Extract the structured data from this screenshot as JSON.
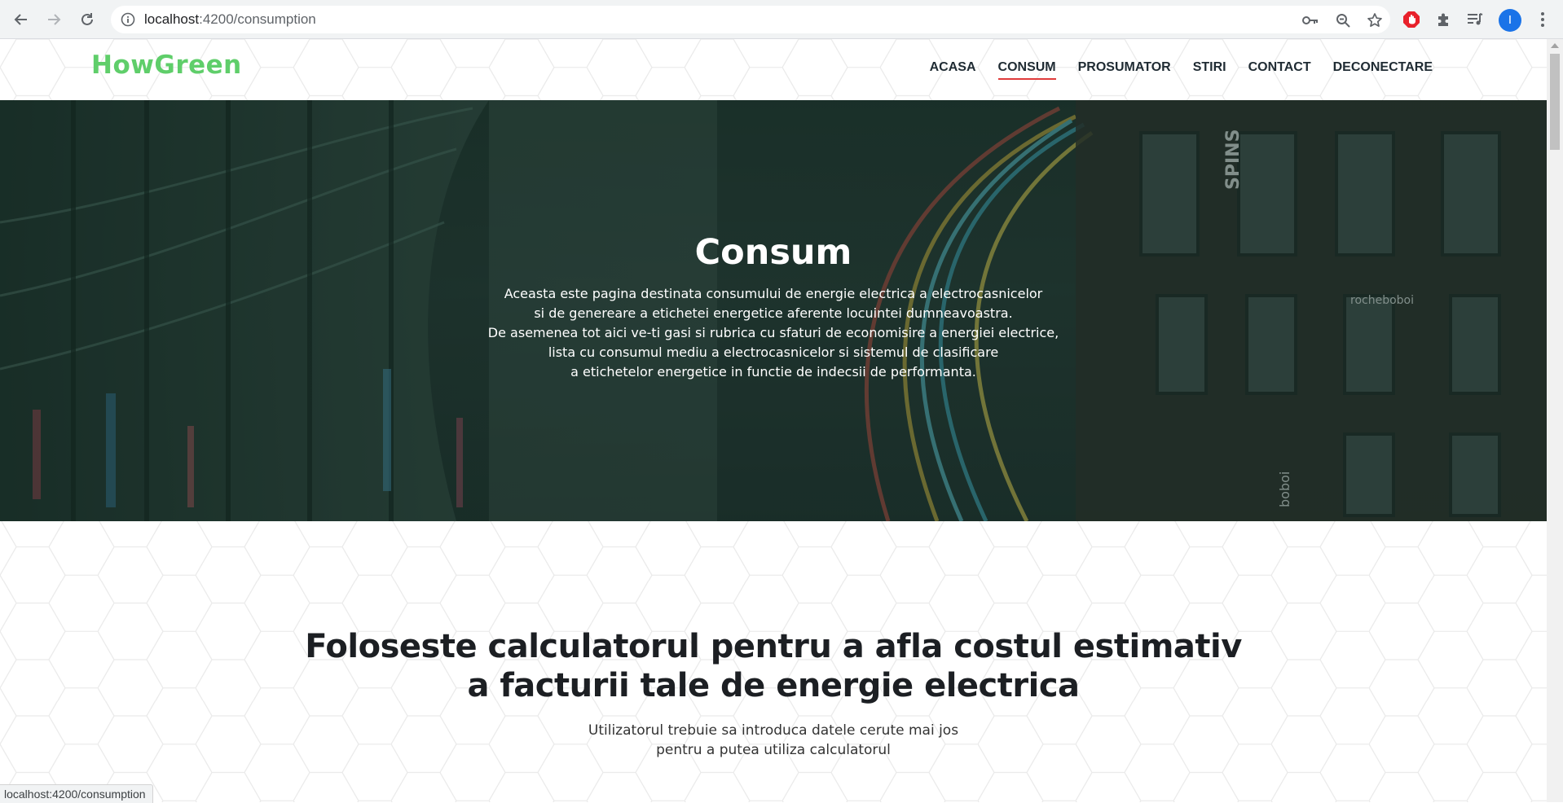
{
  "browser": {
    "url_host": "localhost",
    "url_path": ":4200/consumption",
    "profile_initial": "I",
    "status_url": "localhost:4200/consumption"
  },
  "site": {
    "logo": "HowGreen",
    "nav": [
      {
        "label": "ACASA",
        "active": false
      },
      {
        "label": "CONSUM",
        "active": true
      },
      {
        "label": "PROSUMATOR",
        "active": false
      },
      {
        "label": "STIRI",
        "active": false
      },
      {
        "label": "CONTACT",
        "active": false
      },
      {
        "label": "DECONECTARE",
        "active": false
      }
    ],
    "accent_color": "#5fce6a",
    "active_underline_color": "#e03b3b"
  },
  "hero": {
    "title": "Consum",
    "lines": [
      "Aceasta este pagina destinata consumului de energie electrica a electrocasnicelor",
      "si de genereare a etichetei energetice aferente locuintei dumneavoastra.",
      "De asemenea tot aici ve-ti gasi si rubrica cu sfaturi de economisire a energiei electrice,",
      "lista cu consumul mediu a electrocasnicelor si sistemul de clasificare",
      "a etichetelor energetice in functie de indecsii de performanta."
    ],
    "image_signs": [
      "SPINS",
      "rocheboboi",
      "boboi"
    ]
  },
  "calculator": {
    "title_line1": "Foloseste calculatorul pentru a afla costul estimativ",
    "title_line2": "a facturii tale de energie electrica",
    "sub_line1": "Utilizatorul trebuie sa introduca datele cerute mai jos",
    "sub_line2": "pentru a putea utiliza calculatorul"
  }
}
